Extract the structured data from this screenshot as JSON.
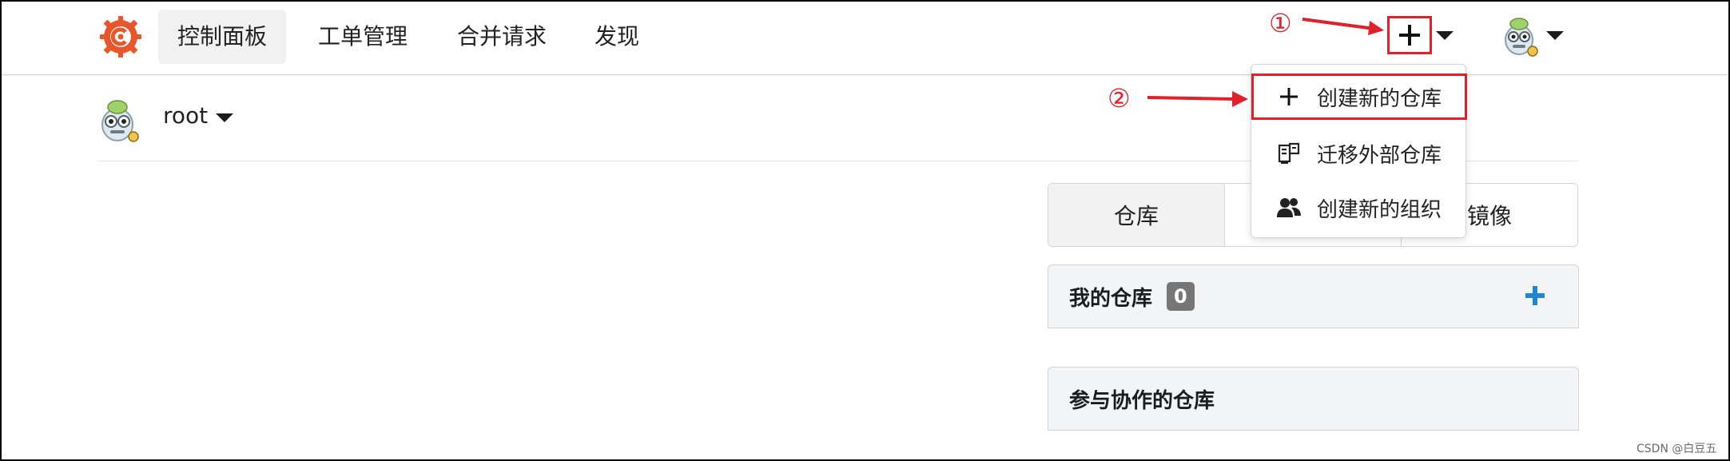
{
  "nav": {
    "items": [
      {
        "label": "控制面板",
        "active": true
      },
      {
        "label": "工单管理"
      },
      {
        "label": "合并请求"
      },
      {
        "label": "发现"
      }
    ]
  },
  "annotations": {
    "one": "①",
    "two": "②"
  },
  "dropdown": {
    "items": [
      {
        "label": "创建新的仓库",
        "icon": "plus-icon"
      },
      {
        "label": "迁移外部仓库",
        "icon": "migrate-icon"
      },
      {
        "label": "创建新的组织",
        "icon": "users-icon"
      }
    ]
  },
  "user": {
    "name": "root"
  },
  "tabs": [
    {
      "label": "仓库",
      "active": true
    },
    {
      "label": ""
    },
    {
      "label": "镜像"
    }
  ],
  "my_repos": {
    "title": "我的仓库",
    "count": "0"
  },
  "collab_repos": {
    "title": "参与协作的仓库"
  },
  "watermark": "CSDN @白豆五",
  "colors": {
    "annotation_red": "#e0202a",
    "logo_orange": "#e8572b",
    "add_blue": "#2185d0"
  }
}
